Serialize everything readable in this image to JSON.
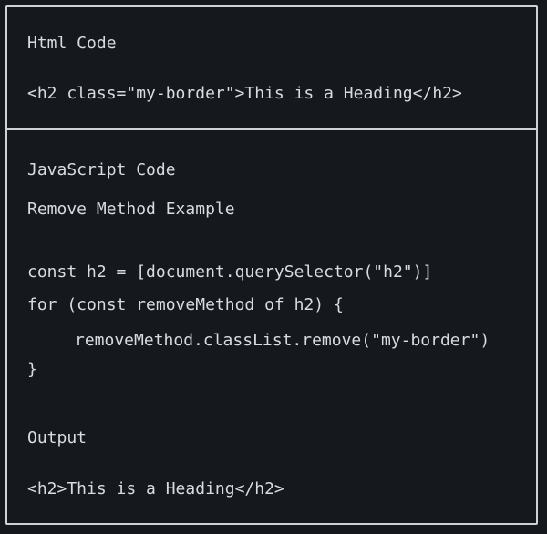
{
  "html_section": {
    "title": "Html Code",
    "code": "<h2 class=\"my-border\">This is a Heading</h2>"
  },
  "js_section": {
    "title": "JavaScript Code",
    "subtitle": "Remove Method Example",
    "code_lines": [
      "const h2 = [document.querySelector(\"h2\")]",
      "for (const removeMethod of h2) {",
      "removeMethod.classList.remove(\"my-border\")",
      "}"
    ]
  },
  "output_section": {
    "title": "Output",
    "code": "<h2>This is a Heading</h2>"
  }
}
